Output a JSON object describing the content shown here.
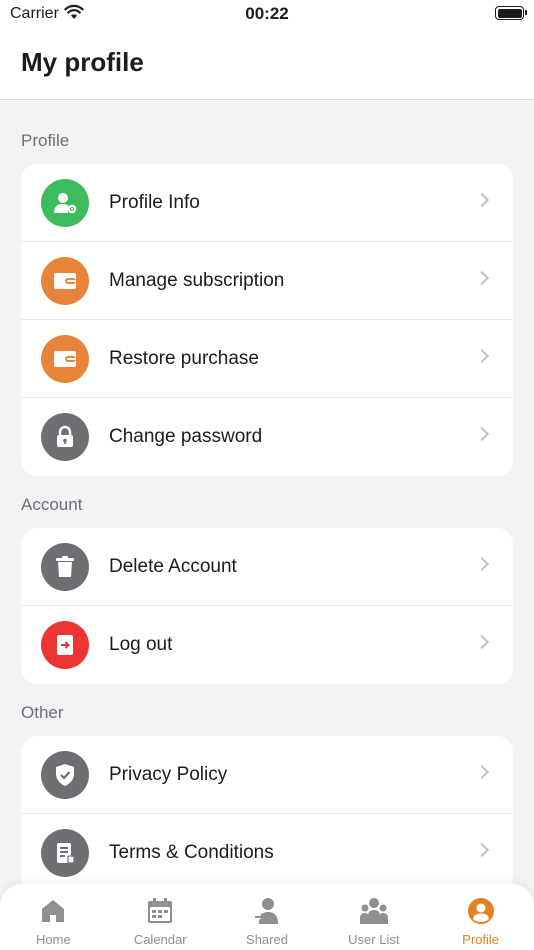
{
  "status_bar": {
    "carrier": "Carrier",
    "time": "00:22"
  },
  "header": {
    "title": "My profile"
  },
  "colors": {
    "green": "#3dbb5d",
    "orange": "#e8843a",
    "gray": "#6e6e73",
    "red": "#ec3434",
    "accent": "#e67e22"
  },
  "sections": [
    {
      "label": "Profile",
      "items": [
        {
          "label": "Profile Info",
          "icon": "user-gear-icon",
          "color": "green"
        },
        {
          "label": "Manage subscription",
          "icon": "wallet-icon",
          "color": "orange"
        },
        {
          "label": "Restore purchase",
          "icon": "wallet-icon",
          "color": "orange"
        },
        {
          "label": "Change password",
          "icon": "lock-icon",
          "color": "gray"
        }
      ]
    },
    {
      "label": "Account",
      "items": [
        {
          "label": "Delete Account",
          "icon": "trash-icon",
          "color": "gray"
        },
        {
          "label": "Log out",
          "icon": "logout-icon",
          "color": "red"
        }
      ]
    },
    {
      "label": "Other",
      "items": [
        {
          "label": "Privacy Policy",
          "icon": "shield-check-icon",
          "color": "gray"
        },
        {
          "label": "Terms & Conditions",
          "icon": "document-icon",
          "color": "gray"
        }
      ]
    }
  ],
  "tab_bar": {
    "tabs": [
      {
        "label": "Home",
        "icon": "home-icon"
      },
      {
        "label": "Calendar",
        "icon": "calendar-icon"
      },
      {
        "label": "Shared",
        "icon": "shared-icon"
      },
      {
        "label": "User List",
        "icon": "users-icon"
      },
      {
        "label": "Profile",
        "icon": "profile-icon",
        "active": true
      }
    ]
  }
}
